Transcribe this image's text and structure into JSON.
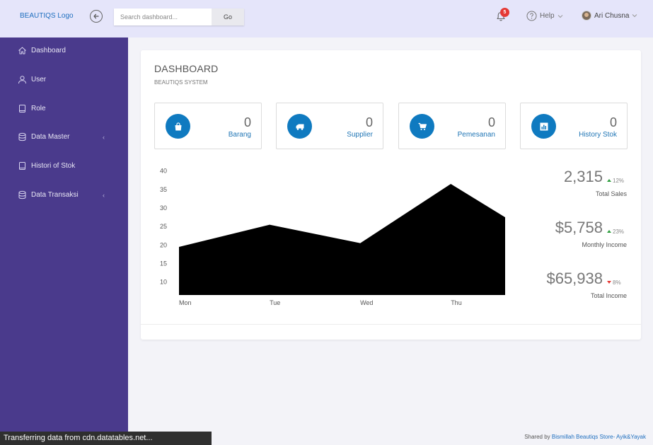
{
  "header": {
    "logo": "BEAUTIQS Logo",
    "search_placeholder": "Search dashboard...",
    "search_button": "Go",
    "notification_count": "5",
    "help_label": "Help",
    "user_name": "Ari Chusna"
  },
  "sidebar": {
    "items": [
      {
        "label": "Dashboard",
        "icon": "home-icon"
      },
      {
        "label": "User",
        "icon": "user-icon"
      },
      {
        "label": "Role",
        "icon": "book-icon"
      },
      {
        "label": "Data Master",
        "icon": "database-icon"
      },
      {
        "label": "Histori of Stok",
        "icon": "book-icon"
      },
      {
        "label": "Data Transaksi",
        "icon": "database-icon"
      }
    ]
  },
  "dashboard": {
    "title": "DASHBOARD",
    "subtitle": "BEAUTIQS SYSTEM",
    "stats": [
      {
        "value": "0",
        "label": "Barang",
        "icon": "shopping-bag-icon"
      },
      {
        "value": "0",
        "label": "Supplier",
        "icon": "truck-icon"
      },
      {
        "value": "0",
        "label": "Pemesanan",
        "icon": "cart-icon"
      },
      {
        "value": "0",
        "label": "History Stok",
        "icon": "bar-chart-icon"
      }
    ],
    "kpis": [
      {
        "value": "2,315",
        "change": "12%",
        "direction": "up",
        "label": "Total Sales"
      },
      {
        "value": "$5,758",
        "change": "23%",
        "direction": "up",
        "label": "Monthly Income"
      },
      {
        "value": "$65,938",
        "change": "8%",
        "direction": "down",
        "label": "Total Income"
      }
    ]
  },
  "chart_data": {
    "type": "area",
    "categories": [
      "Mon",
      "Tue",
      "Wed",
      "Thu"
    ],
    "x": [
      0,
      1,
      2,
      3,
      3.6
    ],
    "values": [
      19.5,
      25.5,
      20.5,
      36.5,
      27.5
    ],
    "yticks": [
      10,
      15,
      20,
      25,
      30,
      35,
      40
    ],
    "ylim": [
      6.5,
      43
    ],
    "xlim": [
      0,
      3.6
    ],
    "fill": "#000000",
    "grid": false
  },
  "status_bar": "Transferring data from cdn.datatables.net...",
  "footer": {
    "prefix": "Shared by",
    "link": "Bismillah Beautiqs Store- Ayik&Yayak"
  }
}
